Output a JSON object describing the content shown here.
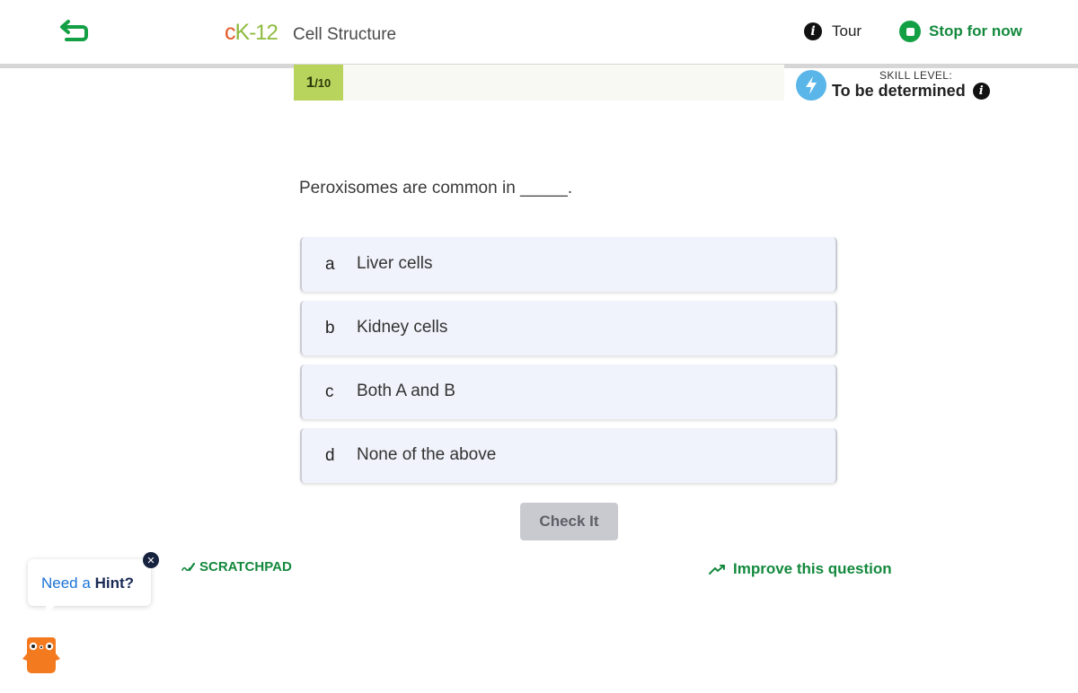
{
  "header": {
    "logo_text_c": "c",
    "logo_text_k": "K",
    "logo_text_num": "-12",
    "lesson_title": "Cell Structure",
    "tour_label": "Tour",
    "stop_label": "Stop for now"
  },
  "progress": {
    "current": "1",
    "total": "/10",
    "fraction": 0.1
  },
  "skill": {
    "caption": "SKILL LEVEL:",
    "value": "To be determined"
  },
  "question": {
    "text": "Peroxisomes are common in _____."
  },
  "options": [
    {
      "letter": "a",
      "text": "Liver cells"
    },
    {
      "letter": "b",
      "text": "Kidney cells"
    },
    {
      "letter": "c",
      "text": "Both A and B"
    },
    {
      "letter": "d",
      "text": "None of the above"
    }
  ],
  "actions": {
    "check_label": "Check It",
    "scratchpad_label": "SCRATCHPAD",
    "improve_label": "Improve this question"
  },
  "hint": {
    "prefix": "Need a",
    "emphasis": "Hint?",
    "close_symbol": "✕"
  },
  "icons": {
    "back": "back-arrow-icon",
    "info": "info-icon",
    "stop": "stop-icon",
    "skill": "lightning-icon",
    "scratchpad": "pencil-scribble-icon",
    "improve": "trend-up-icon",
    "mascot": "mascot-icon"
  },
  "colors": {
    "accent_green": "#13893d",
    "progress_green": "#b9d45c",
    "skill_blue": "#5ab6e8",
    "logo_orange": "#e25a26",
    "link_blue": "#1a72d6"
  }
}
